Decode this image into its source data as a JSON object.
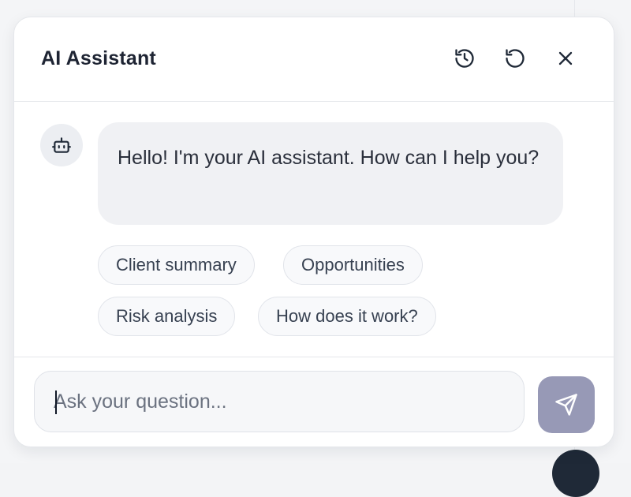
{
  "header": {
    "title": "AI Assistant",
    "icons": [
      "history-icon",
      "refresh-icon",
      "close-icon"
    ]
  },
  "message": {
    "avatar_icon": "bot-icon",
    "text": "Hello! I'm your AI assistant. How can I help you?"
  },
  "suggestions": [
    {
      "label": "Client summary"
    },
    {
      "label": "Opportunities"
    },
    {
      "label": "Risk analysis"
    },
    {
      "label": "How does it work?"
    }
  ],
  "composer": {
    "placeholder": "Ask your question...",
    "value": "",
    "send_icon": "send-icon"
  },
  "colors": {
    "send_button": "#9799b6",
    "bubble": "#f0f1f4",
    "title": "#1e2433"
  }
}
